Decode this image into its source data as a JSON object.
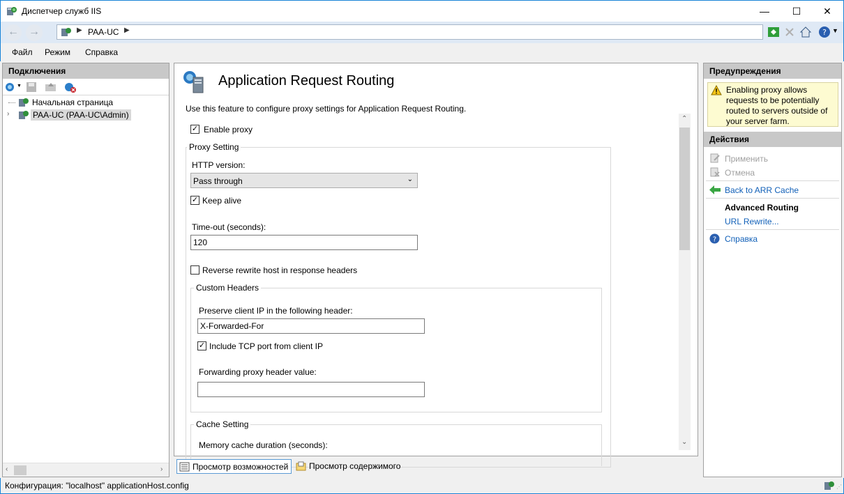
{
  "window": {
    "title": "Диспетчер служб IIS"
  },
  "titlebar_buttons": {
    "minimize": "—",
    "maximize": "☐",
    "close": "✕"
  },
  "address": {
    "crumb": "PAA-UC"
  },
  "menu": [
    "Файл",
    "Режим",
    "Справка"
  ],
  "connections": {
    "header": "Подключения",
    "tree": [
      {
        "label": "Начальная страница"
      },
      {
        "label": "PAA-UC (PAA-UC\\Admin)"
      }
    ]
  },
  "feature": {
    "title": "Application Request Routing",
    "description": "Use this feature to configure proxy settings for Application Request Routing.",
    "enable_proxy": {
      "label": "Enable proxy",
      "checked": true
    },
    "proxy_setting": {
      "legend": "Proxy Setting",
      "http_version_label": "HTTP version:",
      "http_version_value": "Pass through",
      "keep_alive": {
        "label": "Keep alive",
        "checked": true
      },
      "timeout_label": "Time-out (seconds):",
      "timeout_value": "120",
      "reverse_rewrite": {
        "label": "Reverse rewrite host in response headers",
        "checked": false
      }
    },
    "custom_headers": {
      "legend": "Custom Headers",
      "preserve_ip_label": "Preserve client IP in the following header:",
      "preserve_ip_value": "X-Forwarded-For",
      "include_tcp": {
        "label": "Include TCP port from client IP",
        "checked": true
      },
      "forwarding_label": "Forwarding proxy header value:",
      "forwarding_value": ""
    },
    "cache_setting": {
      "legend": "Cache Setting",
      "memory_cache_label": "Memory cache duration (seconds):"
    }
  },
  "view_tabs": [
    "Просмотр возможностей",
    "Просмотр содержимого"
  ],
  "alerts": {
    "header": "Предупреждения",
    "message": "Enabling proxy allows requests to be potentially routed to servers outside of your server farm."
  },
  "actions": {
    "header": "Действия",
    "apply": "Применить",
    "cancel": "Отмена",
    "back": "Back to ARR Cache",
    "advanced_routing": "Advanced Routing",
    "url_rewrite": "URL Rewrite...",
    "help": "Справка"
  },
  "status": {
    "text": "Конфигурация: \"localhost\" applicationHost.config"
  },
  "colors": {
    "accent": "#1883d7",
    "link": "#1160b8",
    "pane_header": "#c8c8c8"
  }
}
